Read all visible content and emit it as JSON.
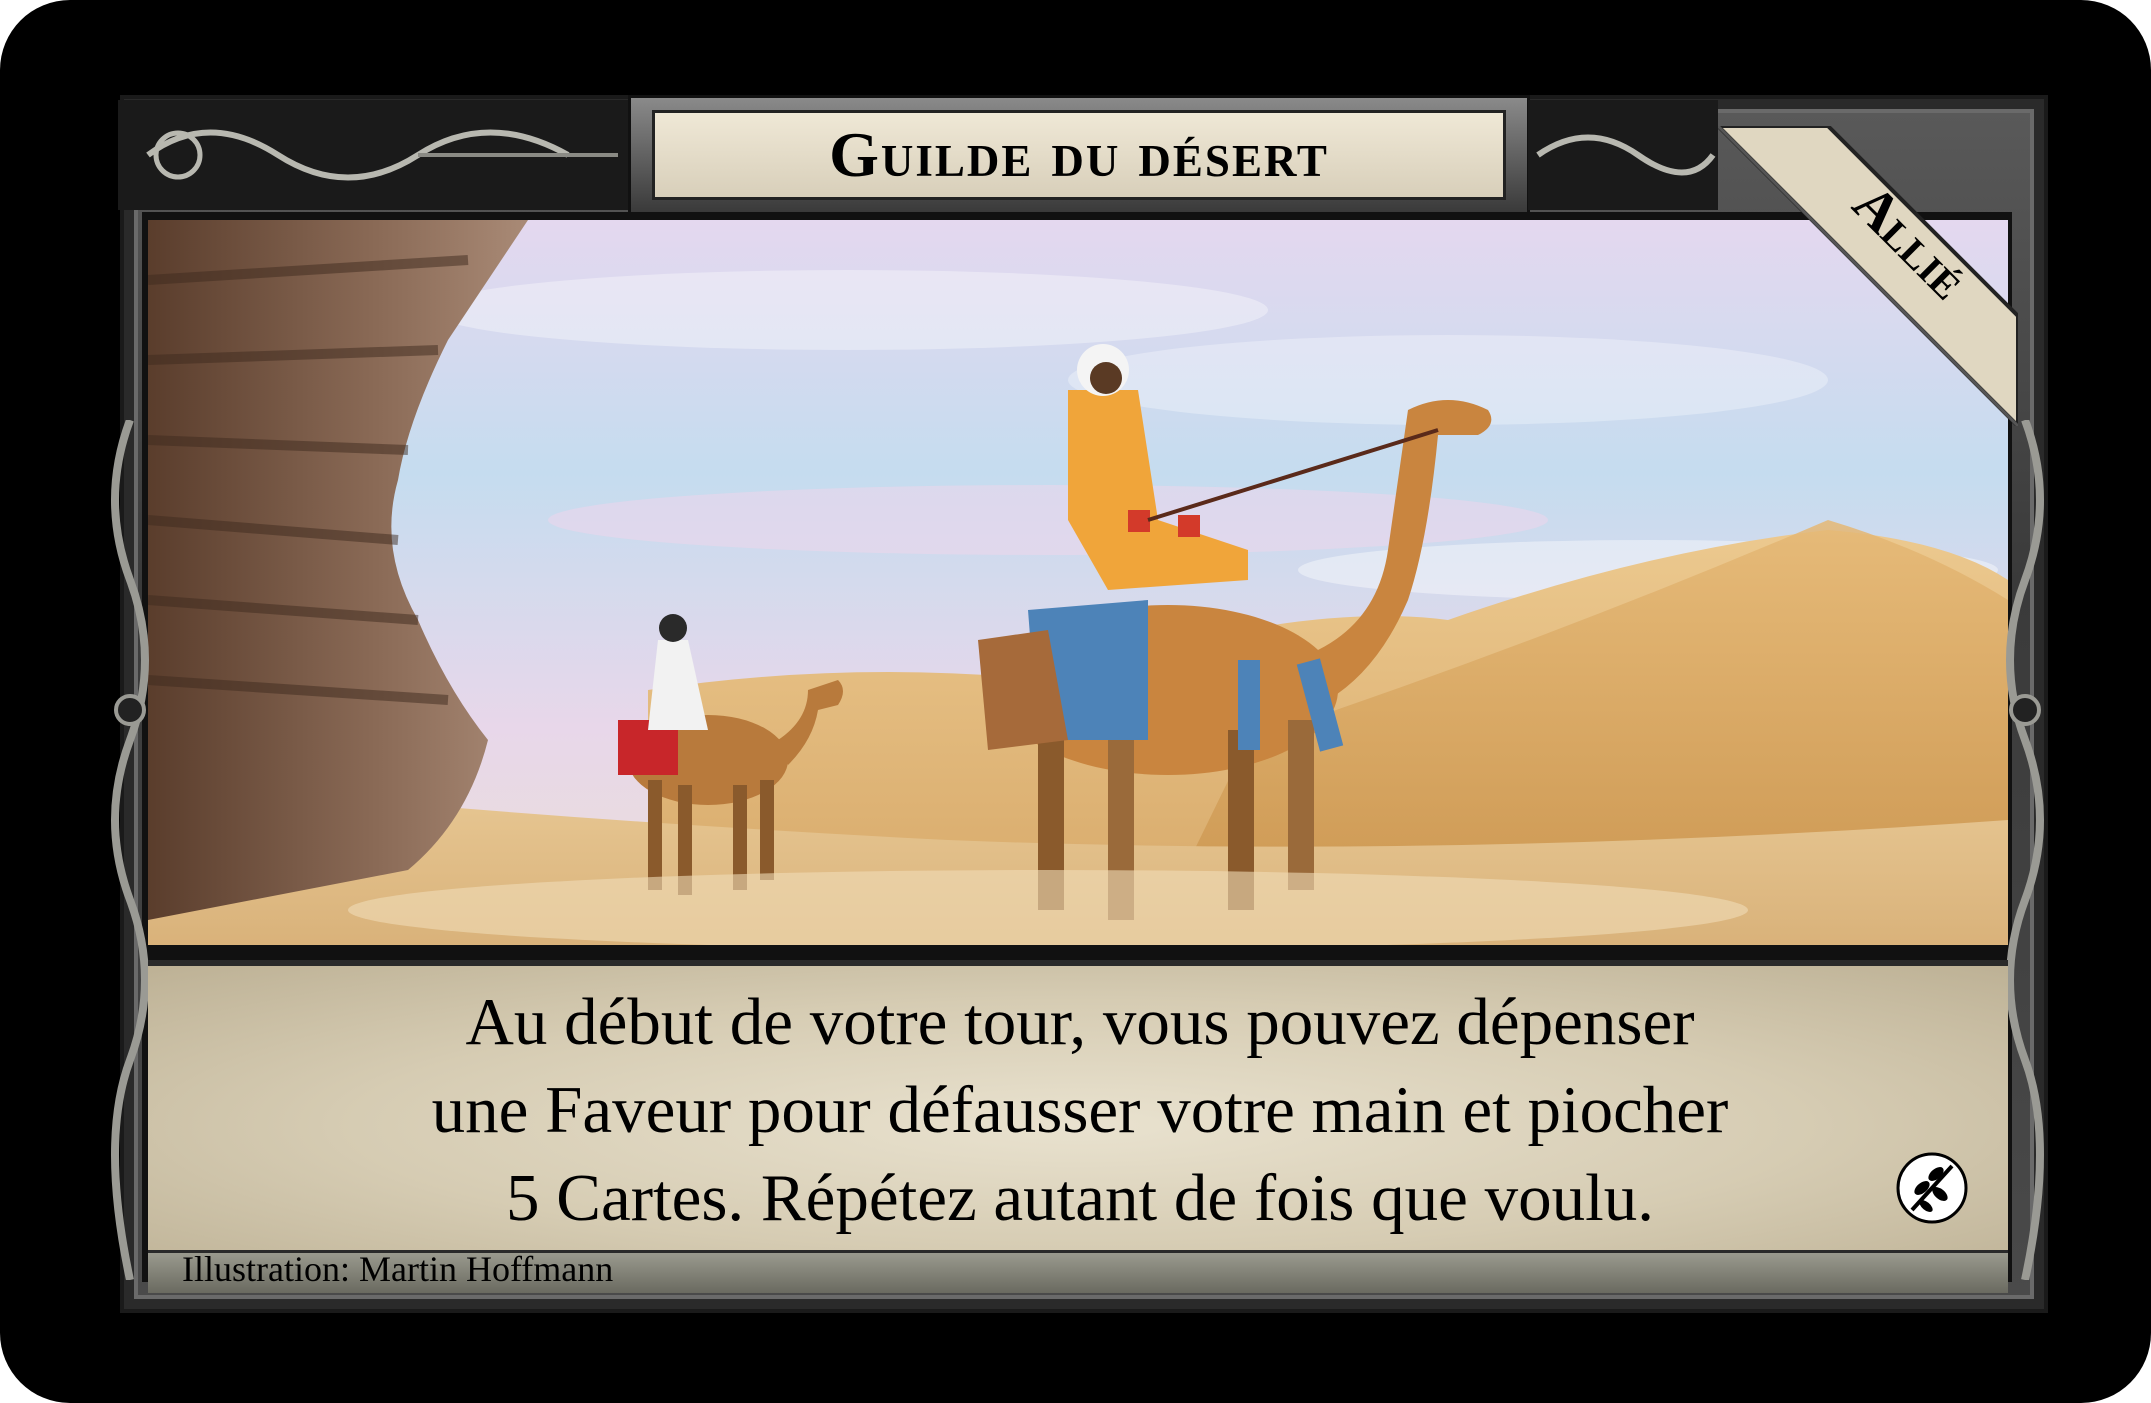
{
  "card": {
    "title": "Guilde du désert",
    "type": "Allié",
    "rules_text_lines": [
      "Au début de votre tour, vous pouvez dépenser",
      "une Faveur pour défausser votre main et piocher",
      "5 Cartes. Répétez autant de fois que voulu."
    ],
    "illustrator": "Illustration: Martin Hoffmann",
    "set_icon": "olive-branch-icon"
  },
  "colors": {
    "card_border": "#000000",
    "frame": "#4a4a4a",
    "parchment": "#e0d7c1",
    "sky": "#c7dcef",
    "sand": "#d9a85c"
  }
}
